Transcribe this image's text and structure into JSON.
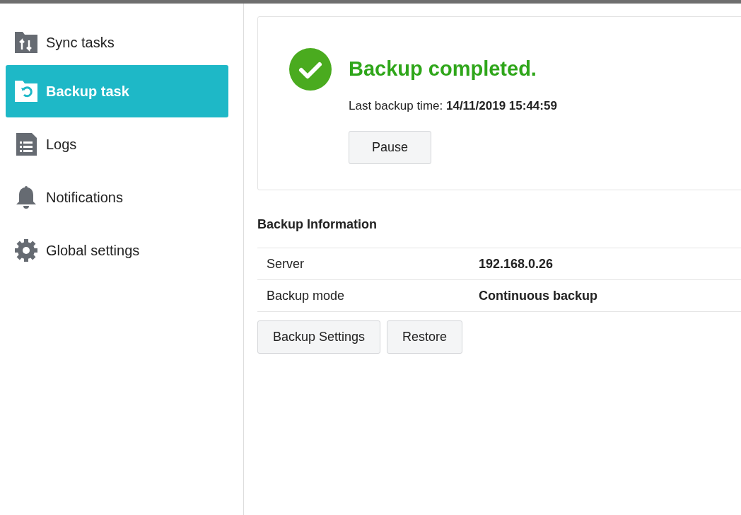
{
  "sidebar": {
    "items": [
      {
        "label": "Sync tasks",
        "kind": "sync",
        "selected": false
      },
      {
        "label": "Backup task",
        "kind": "backup",
        "selected": true
      },
      {
        "label": "Logs",
        "kind": "logs",
        "selected": false
      },
      {
        "label": "Notifications",
        "kind": "bell",
        "selected": false
      },
      {
        "label": "Global settings",
        "kind": "gear",
        "selected": false
      }
    ]
  },
  "status": {
    "kind": "success",
    "title": "Backup completed.",
    "detail": "Last backup time: **14/11/2019 15:44:59**",
    "button": "Pause"
  },
  "info": {
    "title": "Backup Information",
    "rows": [
      {
        "label": "Server",
        "value": "192.168.0.26"
      },
      {
        "label": "Backup mode",
        "value": "Continuous backup"
      }
    ],
    "buttons": [
      "Backup Settings",
      "Restore"
    ]
  }
}
